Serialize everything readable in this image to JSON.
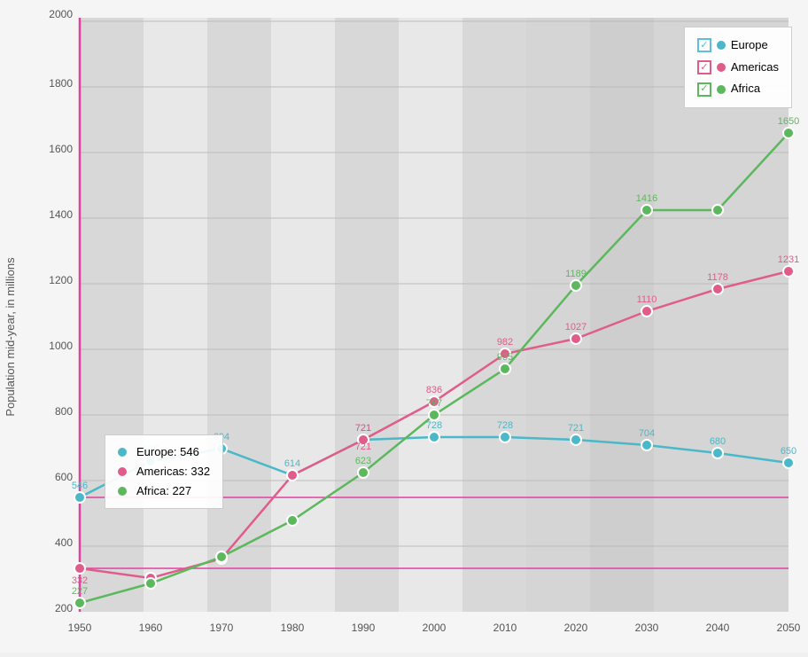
{
  "chart": {
    "title": "Population mid-year, in millions",
    "yAxis": {
      "label": "Population mid-year, in millions",
      "min": 200,
      "max": 2000,
      "ticks": [
        200,
        400,
        600,
        800,
        1000,
        1200,
        1400,
        1600,
        1800,
        2000
      ]
    },
    "xAxis": {
      "ticks": [
        1950,
        1960,
        1970,
        1980,
        1990,
        2000,
        2010,
        2020,
        2030,
        2040,
        2050
      ]
    },
    "series": {
      "europe": {
        "name": "Europe",
        "color": "#4ab8c8",
        "data": [
          {
            "year": 1950,
            "value": 546
          },
          {
            "year": 1960,
            "value": 656
          },
          {
            "year": 1970,
            "value": 694
          },
          {
            "year": 1980,
            "value": 614
          },
          {
            "year": 1990,
            "value": 721
          },
          {
            "year": 2000,
            "value": 728
          },
          {
            "year": 2010,
            "value": 728
          },
          {
            "year": 2020,
            "value": 721
          },
          {
            "year": 2030,
            "value": 704
          },
          {
            "year": 2040,
            "value": 680
          },
          {
            "year": 2050,
            "value": 650
          }
        ]
      },
      "americas": {
        "name": "Americas",
        "color": "#e05c8a",
        "data": [
          {
            "year": 1950,
            "value": 332
          },
          {
            "year": 1960,
            "value": 303
          },
          {
            "year": 1970,
            "value": 362
          },
          {
            "year": 1980,
            "value": 614
          },
          {
            "year": 1990,
            "value": 721
          },
          {
            "year": 2000,
            "value": 836
          },
          {
            "year": 2010,
            "value": 982
          },
          {
            "year": 2020,
            "value": 1027
          },
          {
            "year": 2030,
            "value": 1110
          },
          {
            "year": 2040,
            "value": 1178
          },
          {
            "year": 2050,
            "value": 1231
          }
        ]
      },
      "africa": {
        "name": "Africa",
        "color": "#5cb85c",
        "data": [
          {
            "year": 1950,
            "value": 227
          },
          {
            "year": 1960,
            "value": 285
          },
          {
            "year": 1970,
            "value": 366
          },
          {
            "year": 1980,
            "value": 477
          },
          {
            "year": 1990,
            "value": 623
          },
          {
            "year": 2000,
            "value": 797
          },
          {
            "year": 2010,
            "value": 935
          },
          {
            "year": 2020,
            "value": 1189
          },
          {
            "year": 2030,
            "value": 1416
          },
          {
            "year": 2040,
            "value": 1416
          },
          {
            "year": 2050,
            "value": 1650
          }
        ]
      }
    },
    "legend": {
      "europe_label": "Europe",
      "americas_label": "Americas",
      "africa_label": "Africa"
    },
    "tooltip": {
      "europe_label": "Europe: 546",
      "americas_label": "Americas: 332",
      "africa_label": "Africa: 227"
    },
    "verticalLine": {
      "year": 1950
    },
    "horizontalLine": {
      "value": 546
    }
  }
}
